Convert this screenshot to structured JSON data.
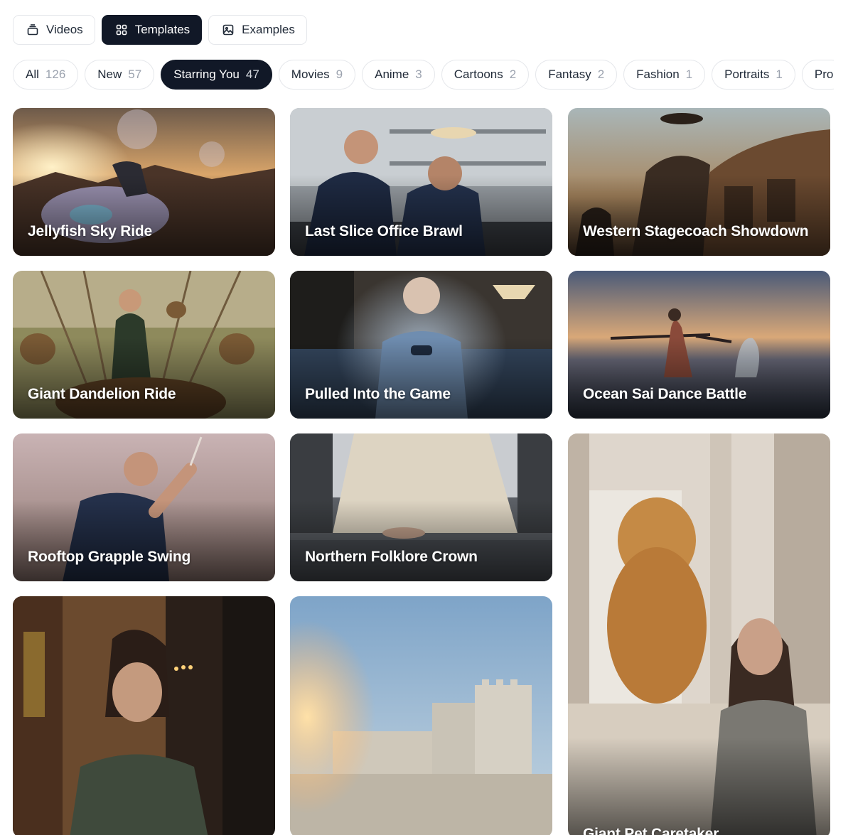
{
  "modes": [
    {
      "label": "Videos",
      "icon": "layers-icon",
      "active": false
    },
    {
      "label": "Templates",
      "icon": "grid-icon",
      "active": true
    },
    {
      "label": "Examples",
      "icon": "image-icon",
      "active": false
    }
  ],
  "categories": [
    {
      "label": "All",
      "count": "126",
      "active": false
    },
    {
      "label": "New",
      "count": "57",
      "active": false
    },
    {
      "label": "Starring You",
      "count": "47",
      "active": true
    },
    {
      "label": "Movies",
      "count": "9",
      "active": false
    },
    {
      "label": "Anime",
      "count": "3",
      "active": false
    },
    {
      "label": "Cartoons",
      "count": "2",
      "active": false
    },
    {
      "label": "Fantasy",
      "count": "2",
      "active": false
    },
    {
      "label": "Fashion",
      "count": "1",
      "active": false
    },
    {
      "label": "Portraits",
      "count": "1",
      "active": false
    },
    {
      "label": "Pro",
      "count": "",
      "active": false
    }
  ],
  "templates": [
    {
      "title": "Jellyfish Sky Ride"
    },
    {
      "title": "Last Slice Office Brawl"
    },
    {
      "title": "Western Stagecoach Showdown"
    },
    {
      "title": "Giant Dandelion Ride"
    },
    {
      "title": "Pulled Into the Game"
    },
    {
      "title": "Ocean Sai Dance Battle"
    },
    {
      "title": "Rooftop Grapple Swing"
    },
    {
      "title": "Northern Folklore Crown"
    },
    {
      "title": ""
    },
    {
      "title": ""
    },
    {
      "title": "Giant Pet Caretaker"
    }
  ]
}
